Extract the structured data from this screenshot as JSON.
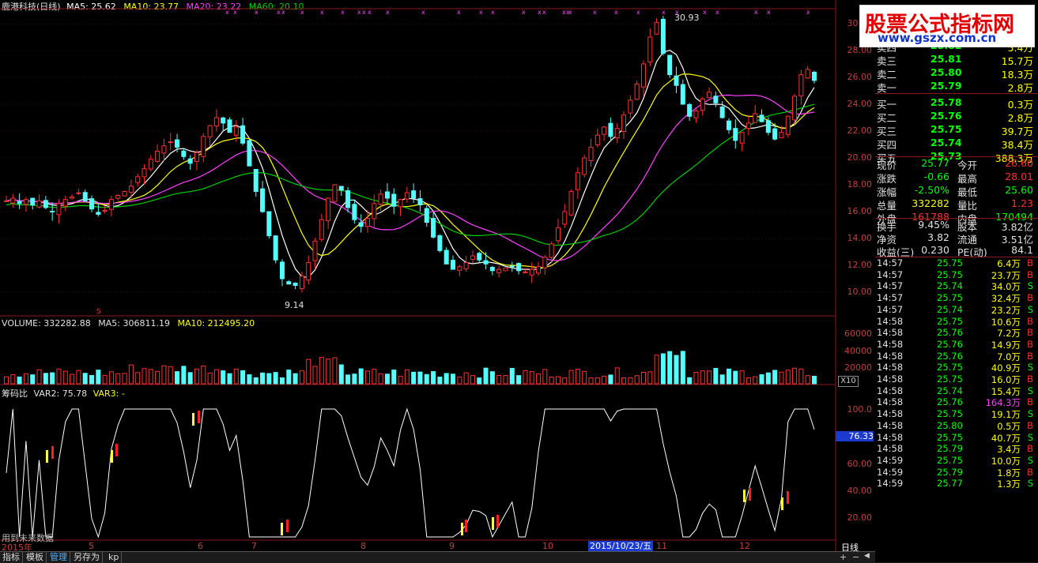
{
  "header": {
    "title": "鹿港科技(日线)",
    "ma5": "MA5: 25.62",
    "ma10": "MA10: 23.77",
    "ma20": "MA20: 23.22",
    "ma60": "MA60: 20.10",
    "colors": {
      "ma5": "#ffffff",
      "ma10": "#ffff00",
      "ma20": "#ff40ff",
      "ma60": "#00cc00"
    }
  },
  "price_panel": {
    "ticks": [
      "30.00",
      "28.00",
      "26.00",
      "24.00",
      "22.00",
      "20.00",
      "18.00",
      "16.00",
      "14.00",
      "12.00",
      "10.00"
    ],
    "high_annot": "30.93",
    "low_annot": "9.14",
    "marker_s": "S"
  },
  "volume_panel": {
    "header_vol": "VOLUME: 332282.88",
    "header_ma5": "MA5: 306811.19",
    "header_ma10": "MA10: 212495.20",
    "ticks": [
      "60000",
      "40000",
      "20000"
    ],
    "unit": "X10"
  },
  "indicator_panel": {
    "header_name": "筹码比",
    "header_var2": "VAR2: 75.78",
    "header_var3": "VAR3: -",
    "ticks": [
      "100.0",
      "80.00",
      "60.00",
      "40.00",
      "20.00"
    ],
    "current_value": "76.33",
    "footnote": "用到未来数据"
  },
  "date_axis": {
    "labels": [
      "2015年",
      "5",
      "6",
      "7",
      "8",
      "9",
      "10",
      "11",
      "12"
    ],
    "cursor_date": "2015/10/23/五",
    "period": "日线"
  },
  "tabs": [
    "指标",
    "模板",
    "管理",
    "另存为",
    "kp"
  ],
  "logo": {
    "line1": "股票公式指标网",
    "line2": "www.gszx.com.cn"
  },
  "order_book": [
    {
      "label": "卖四",
      "price": "25.82",
      "vol": "5.4万"
    },
    {
      "label": "卖三",
      "price": "25.81",
      "vol": "15.7万"
    },
    {
      "label": "卖二",
      "price": "25.80",
      "vol": "18.3万"
    },
    {
      "label": "卖一",
      "price": "25.79",
      "vol": "2.8万"
    },
    {
      "label": "买一",
      "price": "25.78",
      "vol": "0.3万"
    },
    {
      "label": "买二",
      "price": "25.76",
      "vol": "2.8万"
    },
    {
      "label": "买三",
      "price": "25.75",
      "vol": "39.7万"
    },
    {
      "label": "买四",
      "price": "25.74",
      "vol": "38.4万"
    },
    {
      "label": "买五",
      "price": "25.73",
      "vol": "388.3万"
    }
  ],
  "stats": [
    {
      "l1": "现价",
      "v1": "25.77",
      "c1": "#00ff00",
      "l2": "今开",
      "v2": "26.60",
      "c2": "#ff3030"
    },
    {
      "l1": "涨跌",
      "v1": "-0.66",
      "c1": "#00ff00",
      "l2": "最高",
      "v2": "28.01",
      "c2": "#ff3030"
    },
    {
      "l1": "涨幅",
      "v1": "-2.50%",
      "c1": "#00ff00",
      "l2": "最低",
      "v2": "25.60",
      "c2": "#00ff00"
    },
    {
      "l1": "总量",
      "v1": "332282",
      "c1": "#ffff00",
      "l2": "量比",
      "v2": "1.23",
      "c2": "#ff3030"
    },
    {
      "l1": "外盘",
      "v1": "161788",
      "c1": "#ff3030",
      "l2": "内盘",
      "v2": "170494",
      "c2": "#00ff00"
    }
  ],
  "stats2": [
    {
      "l1": "换手",
      "v1": "9.45%",
      "l2": "股本",
      "v2": "3.82亿"
    },
    {
      "l1": "净资",
      "v1": "3.82",
      "l2": "流通",
      "v2": "3.51亿"
    },
    {
      "l1": "收益(三)",
      "v1": "0.230",
      "l2": "PE(动)",
      "v2": "84.1"
    }
  ],
  "ticks_list": [
    {
      "time": "14:57",
      "price": "25.75",
      "vol": "6.4万",
      "side": "B"
    },
    {
      "time": "14:57",
      "price": "25.75",
      "vol": "23.7万",
      "side": "B"
    },
    {
      "time": "14:57",
      "price": "25.74",
      "vol": "34.0万",
      "side": "S"
    },
    {
      "time": "14:57",
      "price": "25.75",
      "vol": "32.4万",
      "side": "B"
    },
    {
      "time": "14:57",
      "price": "25.74",
      "vol": "23.2万",
      "side": "S"
    },
    {
      "time": "14:58",
      "price": "25.75",
      "vol": "10.6万",
      "side": "B"
    },
    {
      "time": "14:58",
      "price": "25.76",
      "vol": "7.2万",
      "side": "B"
    },
    {
      "time": "14:58",
      "price": "25.76",
      "vol": "14.9万",
      "side": "B"
    },
    {
      "time": "14:58",
      "price": "25.76",
      "vol": "7.0万",
      "side": "B"
    },
    {
      "time": "14:58",
      "price": "25.75",
      "vol": "40.9万",
      "side": "S"
    },
    {
      "time": "14:58",
      "price": "25.75",
      "vol": "16.0万",
      "side": "B"
    },
    {
      "time": "14:58",
      "price": "25.74",
      "vol": "15.4万",
      "side": "S"
    },
    {
      "time": "14:58",
      "price": "25.76",
      "vol": "164.3万",
      "side": "B"
    },
    {
      "time": "14:58",
      "price": "25.75",
      "vol": "19.1万",
      "side": "S"
    },
    {
      "time": "14:58",
      "price": "25.80",
      "vol": "0.5万",
      "side": "B"
    },
    {
      "time": "14:58",
      "price": "25.75",
      "vol": "40.7万",
      "side": "S"
    },
    {
      "time": "14:58",
      "price": "25.79",
      "vol": "3.4万",
      "side": "B"
    },
    {
      "time": "14:59",
      "price": "25.75",
      "vol": "10.0万",
      "side": "S"
    },
    {
      "time": "14:59",
      "price": "25.79",
      "vol": "1.8万",
      "side": "B"
    },
    {
      "time": "14:59",
      "price": "25.77",
      "vol": "1.3万",
      "side": "S"
    }
  ],
  "chart_data": {
    "type": "candlestick",
    "title": "鹿港科技(日线)",
    "period": "daily",
    "ylim": [
      9,
      31
    ],
    "closes": [
      16.8,
      17.0,
      16.6,
      16.9,
      16.5,
      16.8,
      16.3,
      16.0,
      16.6,
      16.9,
      17.1,
      17.4,
      16.8,
      16.2,
      15.8,
      16.1,
      16.9,
      17.2,
      17.5,
      17.9,
      18.6,
      19.2,
      19.9,
      20.5,
      20.9,
      21.2,
      20.8,
      20.1,
      19.6,
      20.4,
      21.6,
      22.4,
      23.0,
      22.6,
      21.9,
      22.3,
      21.1,
      19.4,
      17.5,
      16.0,
      14.2,
      12.4,
      11.0,
      10.6,
      10.5,
      11.2,
      12.2,
      13.8,
      15.4,
      17.0,
      18.0,
      17.6,
      16.3,
      15.4,
      14.9,
      15.5,
      16.6,
      17.3,
      17.0,
      16.4,
      16.9,
      17.4,
      17.0,
      16.5,
      15.2,
      14.1,
      13.1,
      12.1,
      11.7,
      11.9,
      12.2,
      12.7,
      12.4,
      12.1,
      11.6,
      11.7,
      11.8,
      11.9,
      11.6,
      11.5,
      11.7,
      11.9,
      12.6,
      13.6,
      14.8,
      16.0,
      17.5,
      18.9,
      20.0,
      20.8,
      21.7,
      22.3,
      21.6,
      22.2,
      23.2,
      24.3,
      25.5,
      27.0,
      29.0,
      30.1,
      27.8,
      26.2,
      25.4,
      24.0,
      23.1,
      23.5,
      24.4,
      24.9,
      24.1,
      23.0,
      22.1,
      21.3,
      21.9,
      22.6,
      23.3,
      22.7,
      21.9,
      21.4,
      21.9,
      23.1,
      24.6,
      26.2,
      26.6,
      25.77
    ],
    "ma5_last": 25.62,
    "ma10_last": 23.77,
    "ma20_last": 23.22,
    "ma60_last": 20.1,
    "high": 30.93,
    "low": 9.14
  }
}
